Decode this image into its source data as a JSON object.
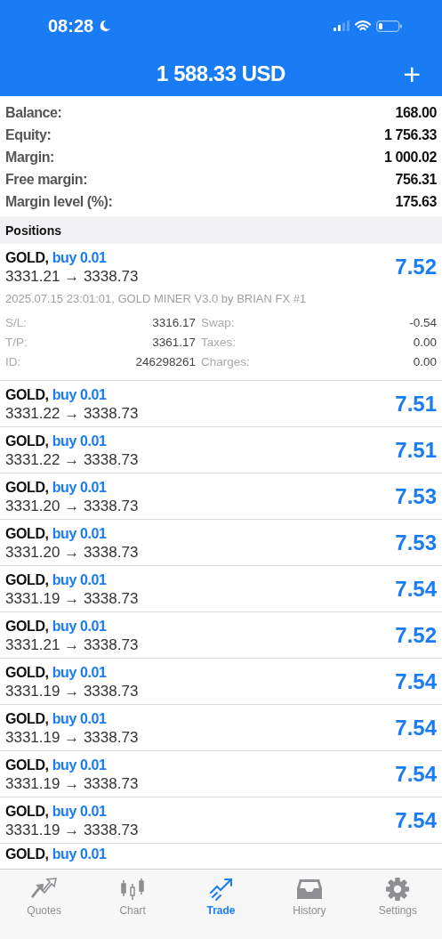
{
  "status_bar": {
    "time": "08:28"
  },
  "header": {
    "title": "1 588.33 USD",
    "action": "+"
  },
  "summary": [
    {
      "label": "Balance:",
      "value": "168.00"
    },
    {
      "label": "Equity:",
      "value": "1 756.33"
    },
    {
      "label": "Margin:",
      "value": "1 000.02"
    },
    {
      "label": "Free margin:",
      "value": "756.31"
    },
    {
      "label": "Margin level (%):",
      "value": "175.63"
    }
  ],
  "positions_heading": "Positions",
  "positions": [
    {
      "kind": "expanded",
      "symbol": "GOLD,",
      "side": "buy 0.01",
      "prices": "3331.21 → 3338.73",
      "profit": "7.52",
      "comment": "2025.07.15 23:01:01, GOLD MINER V3.0 by BRIAN FX #1",
      "details": [
        {
          "label": "S/L:",
          "value": "3316.17",
          "label2": "Swap:",
          "value2": "-0.54"
        },
        {
          "label": "T/P:",
          "value": "3361.17",
          "label2": "Taxes:",
          "value2": "0.00"
        },
        {
          "label": "ID:",
          "value": "246298261",
          "label2": "Charges:",
          "value2": "0.00"
        }
      ]
    },
    {
      "kind": "row",
      "symbol": "GOLD,",
      "side": "buy 0.01",
      "prices": "3331.22 → 3338.73",
      "profit": "7.51"
    },
    {
      "kind": "row",
      "symbol": "GOLD,",
      "side": "buy 0.01",
      "prices": "3331.22 → 3338.73",
      "profit": "7.51"
    },
    {
      "kind": "row",
      "symbol": "GOLD,",
      "side": "buy 0.01",
      "prices": "3331.20 → 3338.73",
      "profit": "7.53"
    },
    {
      "kind": "row",
      "symbol": "GOLD,",
      "side": "buy 0.01",
      "prices": "3331.20 → 3338.73",
      "profit": "7.53"
    },
    {
      "kind": "row",
      "symbol": "GOLD,",
      "side": "buy 0.01",
      "prices": "3331.19 → 3338.73",
      "profit": "7.54"
    },
    {
      "kind": "row",
      "symbol": "GOLD,",
      "side": "buy 0.01",
      "prices": "3331.21 → 3338.73",
      "profit": "7.52"
    },
    {
      "kind": "row",
      "symbol": "GOLD,",
      "side": "buy 0.01",
      "prices": "3331.19 → 3338.73",
      "profit": "7.54"
    },
    {
      "kind": "row",
      "symbol": "GOLD,",
      "side": "buy 0.01",
      "prices": "3331.19 → 3338.73",
      "profit": "7.54"
    },
    {
      "kind": "row",
      "symbol": "GOLD,",
      "side": "buy 0.01",
      "prices": "3331.19 → 3338.73",
      "profit": "7.54"
    },
    {
      "kind": "row",
      "symbol": "GOLD,",
      "side": "buy 0.01",
      "prices": "3331.19 → 3338.73",
      "profit": "7.54"
    },
    {
      "kind": "partial",
      "symbol": "GOLD,",
      "side": "buy 0.01"
    }
  ],
  "tabs": [
    {
      "kind": "quotes",
      "label": "Quotes",
      "selected": false
    },
    {
      "kind": "chart",
      "label": "Chart",
      "selected": false
    },
    {
      "kind": "trade",
      "label": "Trade",
      "selected": true
    },
    {
      "kind": "history",
      "label": "History",
      "selected": false
    },
    {
      "kind": "settings",
      "label": "Settings",
      "selected": false
    }
  ]
}
